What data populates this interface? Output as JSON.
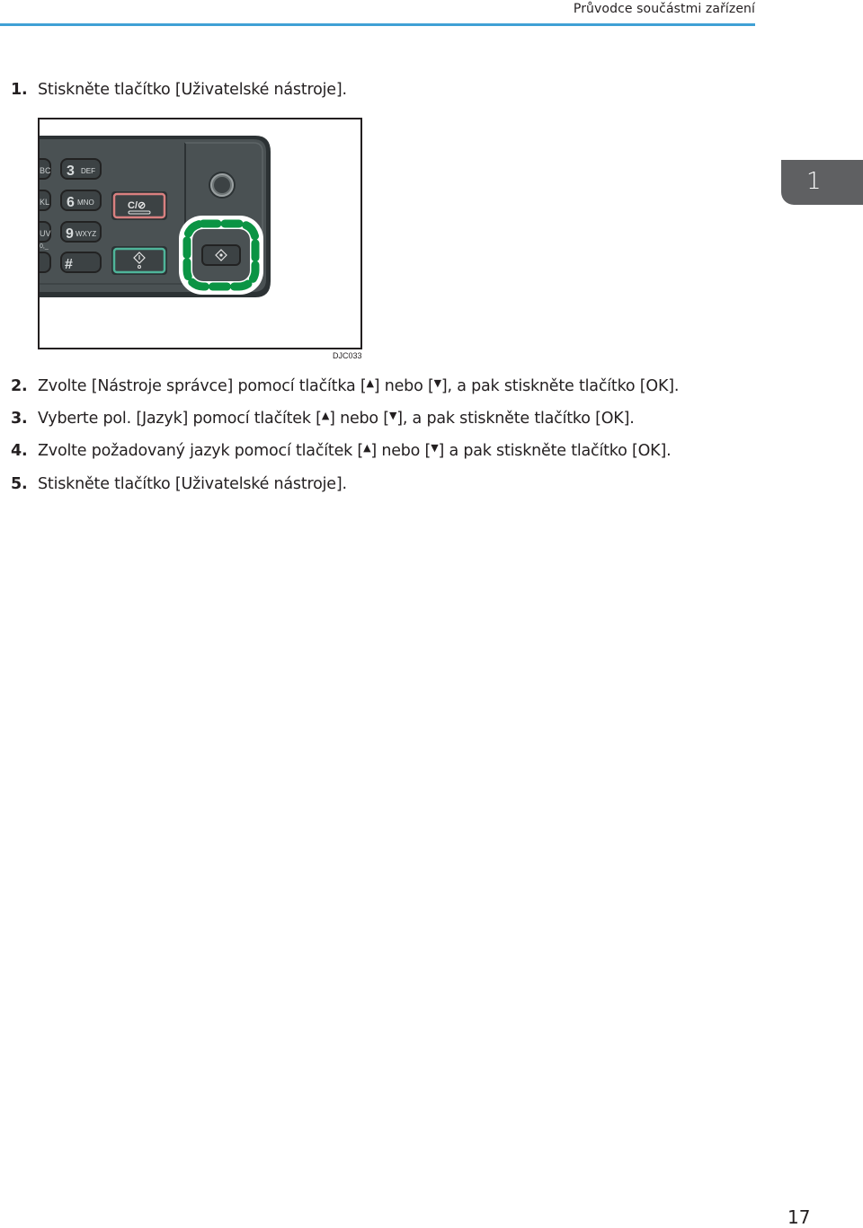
{
  "header": {
    "title": "Průvodce součástmi zařízení",
    "rule_color": "#3fa0d5"
  },
  "chapter_tab": {
    "label": "1",
    "color": "#5f6062"
  },
  "steps": [
    {
      "number": "1.",
      "parts": [
        "Stiskněte tlačítko [Uživatelské nástroje]."
      ]
    },
    {
      "number": "2.",
      "parts": [
        "Zvolte [Nástroje správce] pomocí tlačítka [",
        "▲",
        "] nebo [",
        "▼",
        "], a pak stiskněte tlačítko [OK]."
      ]
    },
    {
      "number": "3.",
      "parts": [
        "Vyberte pol. [Jazyk] pomocí tlačítek [",
        "▲",
        "] nebo [",
        "▼",
        "], a pak stiskněte tlačítko [OK]."
      ]
    },
    {
      "number": "4.",
      "parts": [
        "Zvolte požadovaný jazyk pomocí tlačítek [",
        "▲",
        "] nebo [",
        "▼",
        "] a pak stiskněte tlačítko [OK]."
      ]
    },
    {
      "number": "5.",
      "parts": [
        "Stiskněte tlačítko [Uživatelské nástroje]."
      ]
    }
  ],
  "figure": {
    "id": "DJC033",
    "keys": [
      {
        "digit": "3",
        "letters": "DEF"
      },
      {
        "digit": "6",
        "letters": "MNO"
      },
      {
        "digit": "9",
        "letters": "WXYZ"
      },
      {
        "digit": "#",
        "letters": ""
      }
    ],
    "partial_keys": [
      "BC",
      "KL",
      "UV",
      "0,_"
    ],
    "clear_stop_label": "C/⊘",
    "highlight_color": "#0b9444",
    "panel_color": "#4a5153"
  },
  "page_number": "17"
}
